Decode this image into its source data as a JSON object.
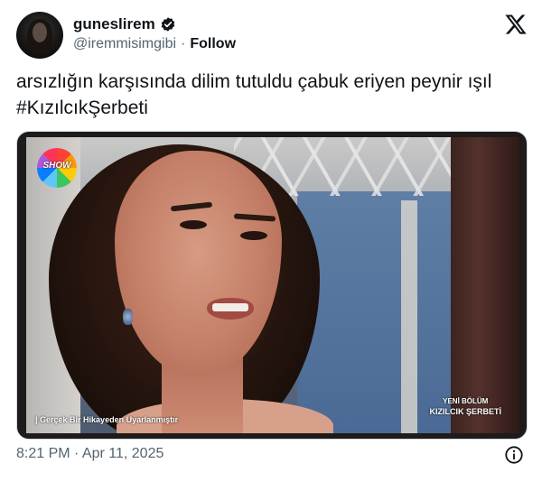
{
  "tweet": {
    "display_name": "guneslirem",
    "handle": "@iremmisimgibi",
    "separator": "·",
    "follow_label": "Follow",
    "text_line1": "arsızlığın karşısında dilim tutuldu çabuk eriyen peynir ışıl",
    "text_line2": "#KızılcıkŞerbeti",
    "timestamp": "8:21 PM · Apr 11, 2025"
  },
  "media": {
    "channel_logo_text": "SHOW",
    "caption_left": "| Gerçek Bir Hikayeden Uyarlanmıştır",
    "caption_right_line1": "YENİ BÖLÜM",
    "caption_right_line2": "KIZILCIK ŞERBETİ"
  },
  "icons": {
    "verified": "verified-badge-icon",
    "platform": "x-logo-icon",
    "info": "info-icon"
  },
  "colors": {
    "text_primary": "#0f1419",
    "text_secondary": "#536471",
    "border": "#cfd9de"
  }
}
